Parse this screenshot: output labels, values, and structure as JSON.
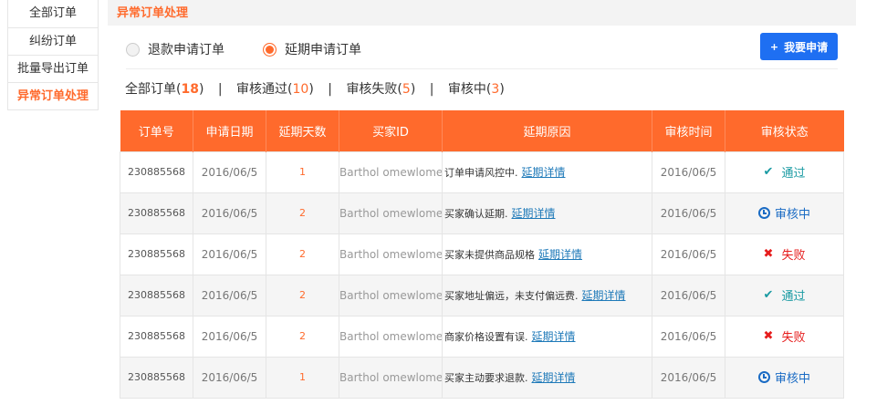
{
  "sidebar": {
    "items": [
      {
        "label": "全部订单"
      },
      {
        "label": "纠纷订单"
      },
      {
        "label": "批量导出订单"
      },
      {
        "label": "异常订单处理"
      }
    ]
  },
  "section_title": "异常订单处理",
  "radios": {
    "refund": "退款申请订单",
    "delay": "延期申请订单",
    "selected": "delay"
  },
  "apply_button": {
    "icon": "+",
    "label": "我要申请"
  },
  "filters": [
    {
      "label": "全部订单(",
      "count": "18",
      "close": ")"
    },
    {
      "label": "审核通过(",
      "count": "10",
      "close": ")"
    },
    {
      "label": "审核失败(",
      "count": "5",
      "close": ")"
    },
    {
      "label": "审核中(",
      "count": "3",
      "close": ")"
    }
  ],
  "filter_separator": "|",
  "table": {
    "headers": [
      "订单号",
      "申请日期",
      "延期天数",
      "买家ID",
      "延期原因",
      "审核时间",
      "审核状态"
    ],
    "link_label": "延期详情",
    "rows": [
      {
        "order": "230885568",
        "date": "2016/06/5",
        "days": "1",
        "buyer": "Barthol omewlome",
        "reason": "订单申请风控中.",
        "review_time": "2016/06/5",
        "status": "通过",
        "status_type": "pass"
      },
      {
        "order": "230885568",
        "date": "2016/06/5",
        "days": "2",
        "buyer": "Barthol omewlome",
        "reason": "买家确认延期.",
        "review_time": "2016/06/5",
        "status": "审核中",
        "status_type": "review"
      },
      {
        "order": "230885568",
        "date": "2016/06/5",
        "days": "2",
        "buyer": "Barthol omewlome",
        "reason": "买家未提供商品规格",
        "review_time": "2016/06/5",
        "status": "失败",
        "status_type": "fail"
      },
      {
        "order": "230885568",
        "date": "2016/06/5",
        "days": "2",
        "buyer": "Barthol omewlome",
        "reason": "买家地址偏远，未支付偏远费.",
        "review_time": "2016/06/5",
        "status": "通过",
        "status_type": "pass"
      },
      {
        "order": "230885568",
        "date": "2016/06/5",
        "days": "2",
        "buyer": "Barthol omewlome",
        "reason": "商家价格设置有误.",
        "review_time": "2016/06/5",
        "status": "失败",
        "status_type": "fail"
      },
      {
        "order": "230885568",
        "date": "2016/06/5",
        "days": "1",
        "buyer": "Barthol omewlome",
        "reason": "买家主动要求退款.",
        "review_time": "2016/06/5",
        "status": "审核中",
        "status_type": "review"
      }
    ]
  },
  "colors": {
    "accent": "#ff6a2c",
    "primary_button": "#1e6ff2",
    "pass": "#199aa2",
    "fail": "#e61c1c",
    "review": "#1a6bc4"
  }
}
